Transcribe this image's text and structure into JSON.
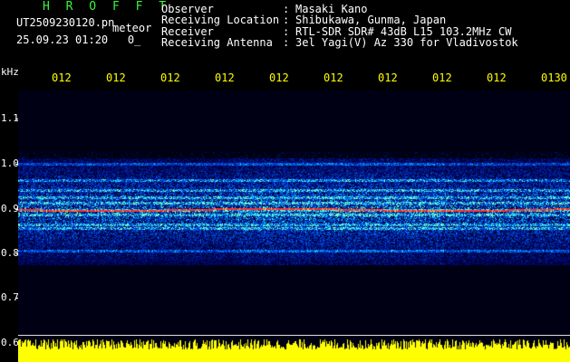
{
  "header": {
    "brand": "H R O F F T",
    "file_name": "UT2509230120.pn",
    "detect_type": "meteor",
    "timestamp": "25.09.23 01:20   0_"
  },
  "station": [
    {
      "label": "Observer",
      "value": "Masaki Kano"
    },
    {
      "label": "Receiving Location",
      "value": "Shibukawa, Gunma, Japan"
    },
    {
      "label": "Receiver",
      "value": "RTL-SDR SDR# 43dB L15 103.2MHz CW"
    },
    {
      "label": "Receiving Antenna",
      "value": "3el Yagi(V) Az 330 for Vladivostok"
    }
  ],
  "axis": {
    "unit": "kHz",
    "time_ticks": [
      "012",
      "012",
      "012",
      "012",
      "012",
      "012",
      "012",
      "012",
      "012",
      "0130"
    ],
    "freq_ticks": [
      "1.1",
      "1.0",
      "0.9",
      "0.8",
      "0.7",
      "0.6"
    ]
  },
  "colors": {
    "background": "#000000",
    "header_brand": "#3df23d",
    "text": "#ffffff",
    "time_ticks": "#ffff00",
    "level_bar": "#ffff00",
    "signal_line": "#ff3030"
  }
}
